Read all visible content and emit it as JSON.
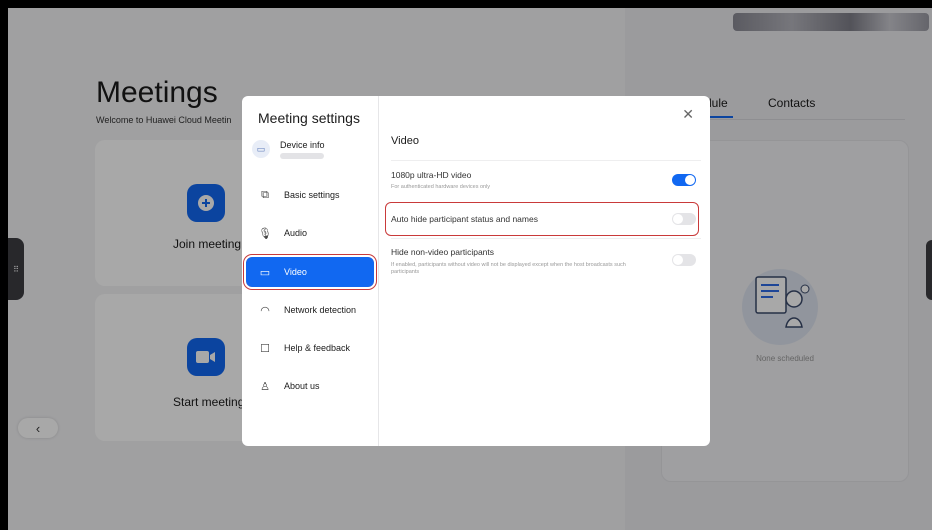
{
  "meetings": {
    "title": "Meetings",
    "subtitle": "Welcome to Huawei Cloud Meetin",
    "join_label": "Join meeting",
    "start_label": "Start meeting"
  },
  "right_panel": {
    "tab_schedule": "dule",
    "tab_contacts": "Contacts",
    "empty_text": "None scheduled"
  },
  "dialog": {
    "title": "Meeting settings",
    "device_label": "Device info",
    "nav": [
      {
        "label": "Basic settings",
        "icon": "basic-settings-icon"
      },
      {
        "label": "Audio",
        "icon": "microphone-icon"
      },
      {
        "label": "Video",
        "icon": "video-icon"
      },
      {
        "label": "Network detection",
        "icon": "wifi-icon"
      },
      {
        "label": "Help & feedback",
        "icon": "feedback-icon"
      },
      {
        "label": "About us",
        "icon": "user-icon"
      }
    ],
    "section_title": "Video",
    "options": [
      {
        "title": "1080p ultra-HD video",
        "desc": "For authenticated hardware devices only",
        "enabled": true
      },
      {
        "title": "Auto hide participant status and names",
        "desc": "",
        "enabled": false
      },
      {
        "title": "Hide non-video participants",
        "desc": "If enabled, participants without video will not be displayed except when the host broadcasts such participants",
        "enabled": false
      }
    ]
  },
  "colors": {
    "accent": "#1168f1",
    "highlight": "#c93a3a"
  }
}
